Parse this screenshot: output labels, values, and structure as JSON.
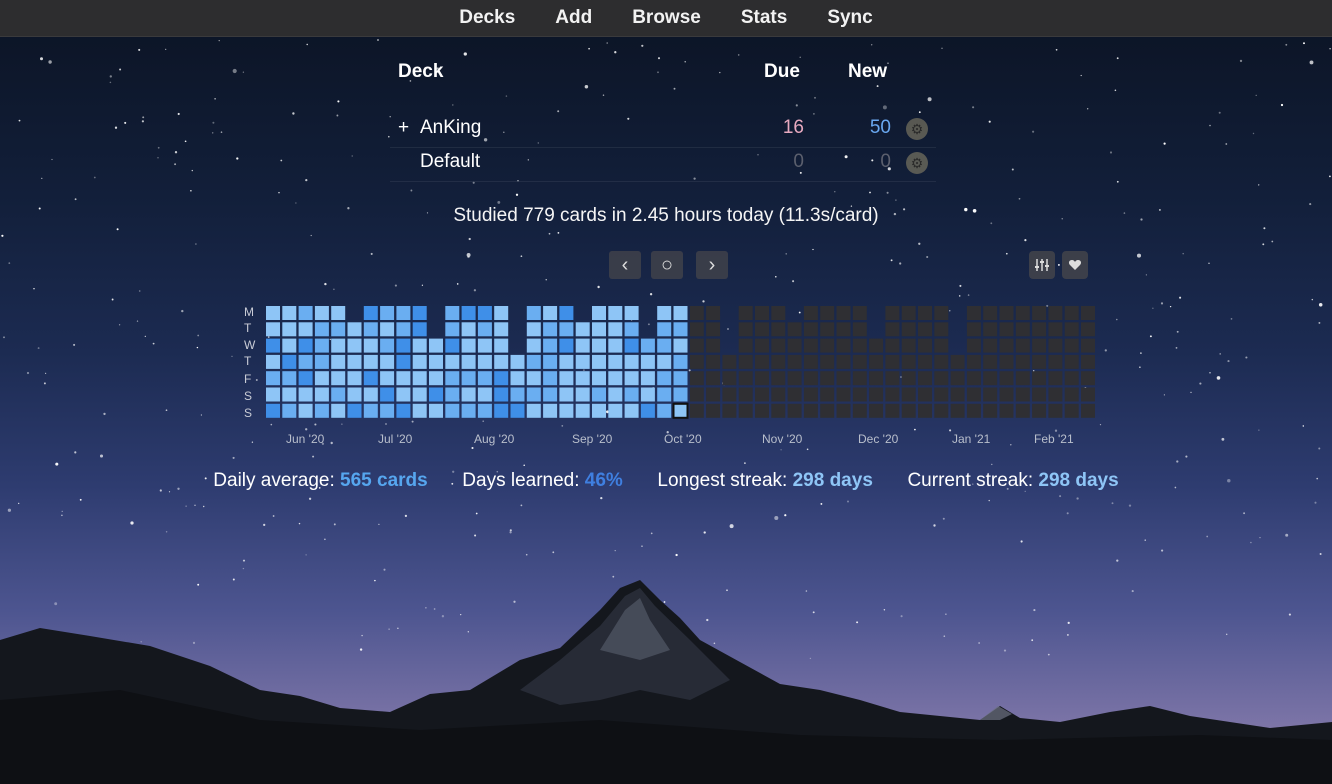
{
  "toolbar": {
    "items": [
      "Decks",
      "Add",
      "Browse",
      "Stats",
      "Sync"
    ]
  },
  "deck_table": {
    "headers": {
      "deck": "Deck",
      "due": "Due",
      "new": "New"
    },
    "rows": [
      {
        "expander": "+",
        "name": "AnKing",
        "due": "16",
        "new": "50"
      },
      {
        "expander": "",
        "name": "Default",
        "due": "0",
        "new": "0"
      }
    ],
    "colors": {
      "due": "#e8aac0",
      "new": "#6aa8f0",
      "zero": "#5b5f6d"
    }
  },
  "studied_text": "Studied 779 cards in 2.45 hours today (11.3s/card)",
  "heatmap_controls": {
    "prev": "‹",
    "today": "○",
    "next": "›",
    "options_icon": "sliders-icon",
    "heart_icon": "heart-icon"
  },
  "heatmap": {
    "weekdays": [
      "M",
      "T",
      "W",
      "T",
      "F",
      "S",
      "S"
    ],
    "months": [
      "Jun '20",
      "Jul '20",
      "Aug '20",
      "Sep '20",
      "Oct '20",
      "Nov '20",
      "Dec '20",
      "Jan '21",
      "Feb '21"
    ],
    "colors": {
      "past_light": "#8ec5f6",
      "past_mid": "#6aaef1",
      "past_dark": "#3f8fe8",
      "future": "#2f2f33"
    }
  },
  "stats": {
    "daily_average_label": "Daily average:",
    "daily_average_value": "565 cards",
    "days_learned_label": "Days learned:",
    "days_learned_value": "46%",
    "longest_streak_label": "Longest streak:",
    "longest_streak_value": "298 days",
    "current_streak_label": "Current streak:",
    "current_streak_value": "298 days"
  }
}
